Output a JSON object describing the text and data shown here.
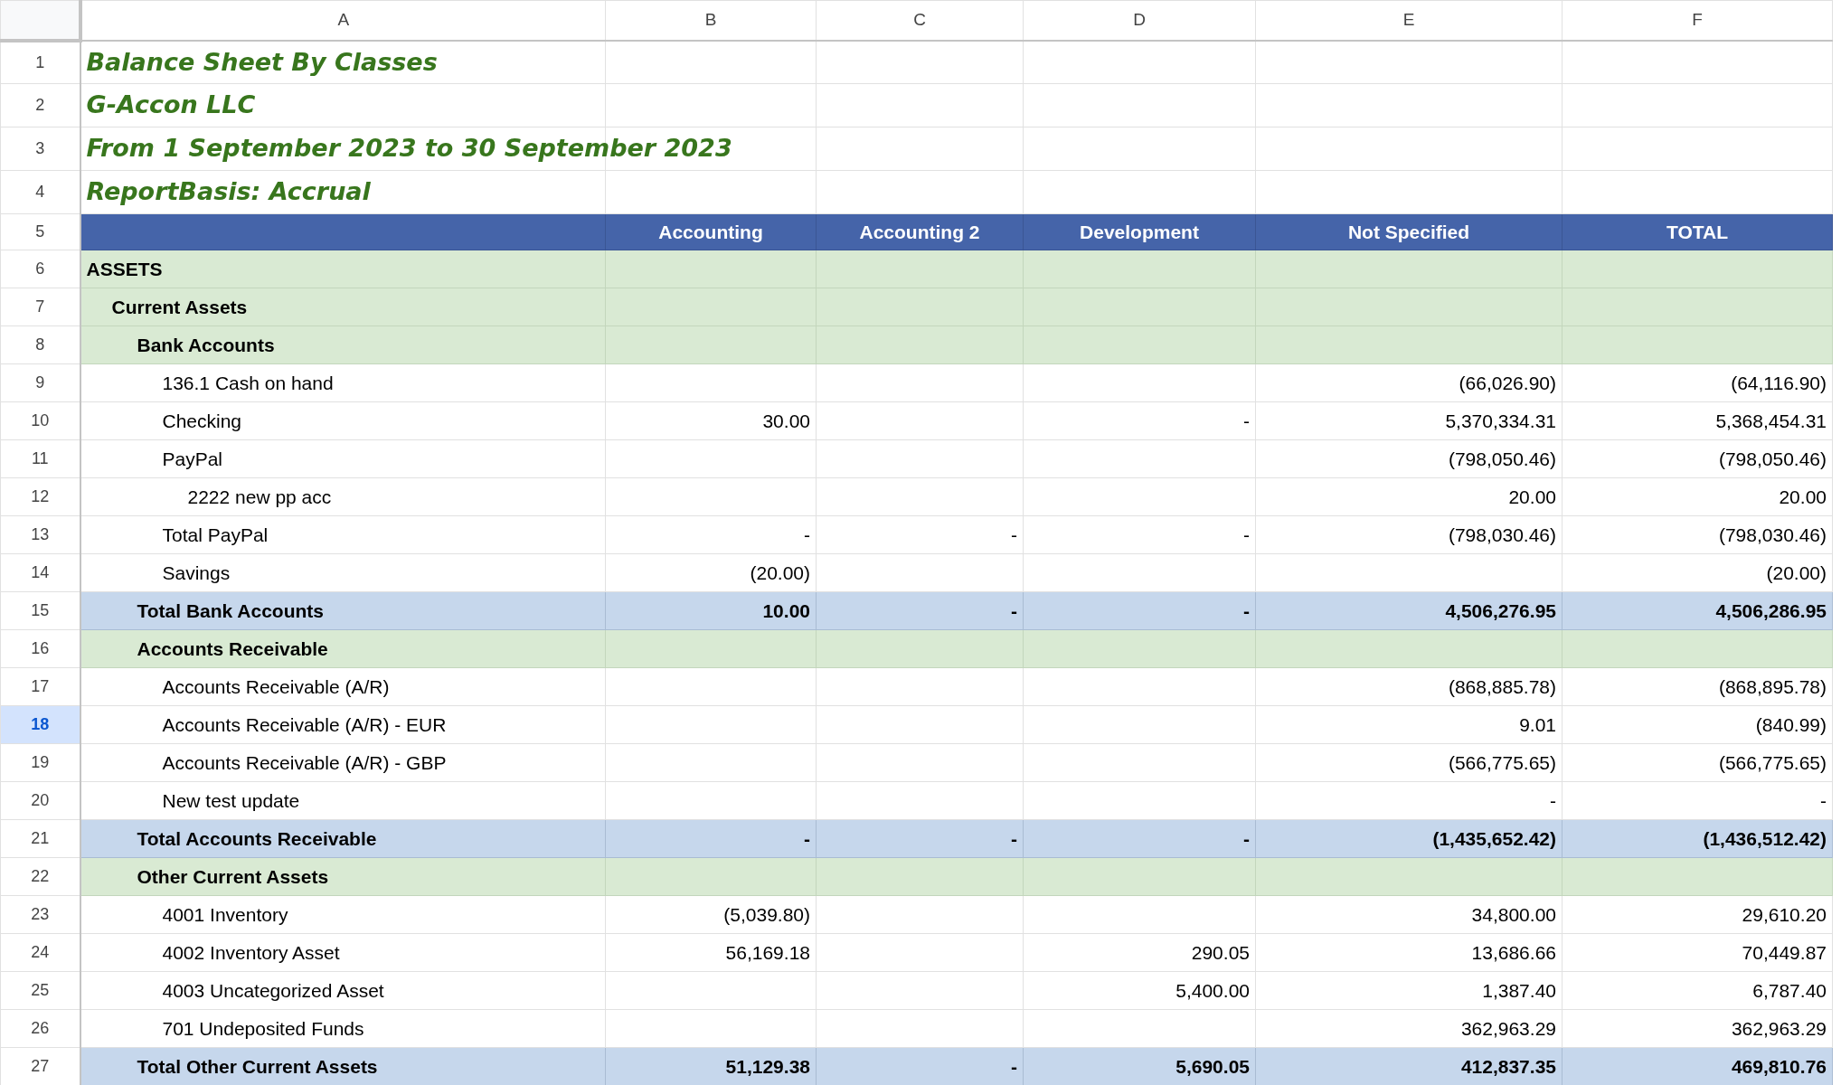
{
  "columns": [
    {
      "letter": "A",
      "selected": false
    },
    {
      "letter": "B",
      "selected": false
    },
    {
      "letter": "C",
      "selected": false
    },
    {
      "letter": "D",
      "selected": false
    },
    {
      "letter": "E",
      "selected": false
    },
    {
      "letter": "F",
      "selected": false
    }
  ],
  "rows": [
    {
      "number": "1",
      "selected": false,
      "kind": "title",
      "label": "Balance Sheet By Classes"
    },
    {
      "number": "2",
      "selected": false,
      "kind": "title",
      "label": "G-Accon LLC"
    },
    {
      "number": "3",
      "selected": false,
      "kind": "title",
      "label": "From 1 September 2023 to 30 September 2023"
    },
    {
      "number": "4",
      "selected": false,
      "kind": "title",
      "label": "ReportBasis: Accrual"
    },
    {
      "number": "5",
      "selected": false,
      "kind": "header",
      "values": {
        "B": "Accounting",
        "C": "Accounting 2",
        "D": "Development",
        "E": "Not Specified",
        "F": "TOTAL"
      }
    },
    {
      "number": "6",
      "selected": false,
      "kind": "section",
      "label": "ASSETS"
    },
    {
      "number": "7",
      "selected": false,
      "kind": "subsection",
      "label": "Current Assets"
    },
    {
      "number": "8",
      "selected": false,
      "kind": "group",
      "label": "Bank Accounts"
    },
    {
      "number": "9",
      "selected": false,
      "kind": "item",
      "label": "136.1 Cash on hand",
      "values": {
        "E": "(66,026.90)",
        "F": "(64,116.90)"
      }
    },
    {
      "number": "10",
      "selected": false,
      "kind": "item",
      "label": "Checking",
      "values": {
        "B": "30.00",
        "D": "-",
        "E": "5,370,334.31",
        "F": "5,368,454.31"
      }
    },
    {
      "number": "11",
      "selected": false,
      "kind": "item",
      "label": "PayPal",
      "values": {
        "E": "(798,050.46)",
        "F": "(798,050.46)"
      }
    },
    {
      "number": "12",
      "selected": false,
      "kind": "subitem",
      "label": "2222 new pp acc",
      "values": {
        "E": "20.00",
        "F": "20.00"
      }
    },
    {
      "number": "13",
      "selected": false,
      "kind": "item",
      "label": "Total PayPal",
      "values": {
        "B": "-",
        "C": "-",
        "D": "-",
        "E": "(798,030.46)",
        "F": "(798,030.46)"
      }
    },
    {
      "number": "14",
      "selected": false,
      "kind": "item",
      "label": "Savings",
      "values": {
        "B": "(20.00)",
        "F": "(20.00)"
      }
    },
    {
      "number": "15",
      "selected": false,
      "kind": "total",
      "label": "Total Bank Accounts",
      "values": {
        "B": "10.00",
        "C": "-",
        "D": "-",
        "E": "4,506,276.95",
        "F": "4,506,286.95"
      }
    },
    {
      "number": "16",
      "selected": false,
      "kind": "group",
      "label": "Accounts Receivable"
    },
    {
      "number": "17",
      "selected": false,
      "kind": "item",
      "label": "Accounts Receivable (A/R)",
      "values": {
        "E": "(868,885.78)",
        "F": "(868,895.78)"
      }
    },
    {
      "number": "18",
      "selected": true,
      "kind": "item",
      "label": "Accounts Receivable (A/R) - EUR",
      "values": {
        "E": "9.01",
        "F": "(840.99)"
      }
    },
    {
      "number": "19",
      "selected": false,
      "kind": "item",
      "label": "Accounts Receivable (A/R) - GBP",
      "values": {
        "E": "(566,775.65)",
        "F": "(566,775.65)"
      }
    },
    {
      "number": "20",
      "selected": false,
      "kind": "item",
      "label": "New test update",
      "values": {
        "E": "-",
        "F": "-"
      }
    },
    {
      "number": "21",
      "selected": false,
      "kind": "total",
      "label": "Total Accounts Receivable",
      "values": {
        "B": "-",
        "C": "-",
        "D": "-",
        "E": "(1,435,652.42)",
        "F": "(1,436,512.42)"
      }
    },
    {
      "number": "22",
      "selected": false,
      "kind": "group",
      "label": "Other Current Assets"
    },
    {
      "number": "23",
      "selected": false,
      "kind": "item",
      "label": "4001 Inventory",
      "values": {
        "B": "(5,039.80)",
        "E": "34,800.00",
        "F": "29,610.20"
      }
    },
    {
      "number": "24",
      "selected": false,
      "kind": "item",
      "label": "4002 Inventory Asset",
      "values": {
        "B": "56,169.18",
        "D": "290.05",
        "E": "13,686.66",
        "F": "70,449.87"
      }
    },
    {
      "number": "25",
      "selected": false,
      "kind": "item",
      "label": "4003 Uncategorized Asset",
      "values": {
        "D": "5,400.00",
        "E": "1,387.40",
        "F": "6,787.40"
      }
    },
    {
      "number": "26",
      "selected": false,
      "kind": "item",
      "label": "701 Undeposited Funds",
      "values": {
        "E": "362,963.29",
        "F": "362,963.29"
      }
    },
    {
      "number": "27",
      "selected": false,
      "kind": "total",
      "label": "Total Other Current Assets",
      "values": {
        "B": "51,129.38",
        "C": "-",
        "D": "5,690.05",
        "E": "412,837.35",
        "F": "469,810.76"
      }
    }
  ]
}
